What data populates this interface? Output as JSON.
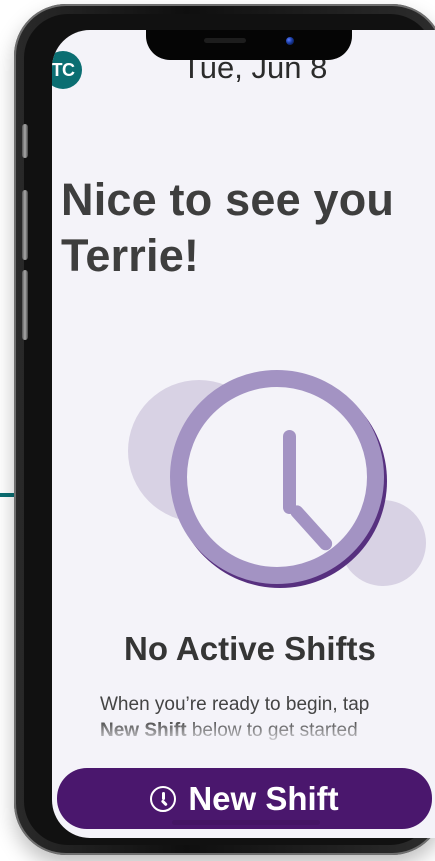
{
  "header": {
    "avatar_initials": "TC",
    "date": "Tue, Jun 8"
  },
  "welcome": {
    "line1": "Nice to see you",
    "line2": "Terrie!"
  },
  "status": {
    "title": "No Active Shifts",
    "instruction_prefix": "When you’re ready to begin, tap",
    "instruction_strong": "New Shift",
    "instruction_suffix": " below to get started"
  },
  "actions": {
    "new_shift_label": "New Shift"
  },
  "icons": {
    "avatar": "avatar",
    "clock": "clock-icon",
    "button_clock": "clock-icon"
  },
  "colors": {
    "screen_background": "#f4f3f9",
    "primary_purple": "#4a176d",
    "clock_purple": "#a393c3",
    "bubble_lavender": "#d8d2e4",
    "avatar_teal": "#0b6e72",
    "text_dark": "#3e3e3e"
  }
}
